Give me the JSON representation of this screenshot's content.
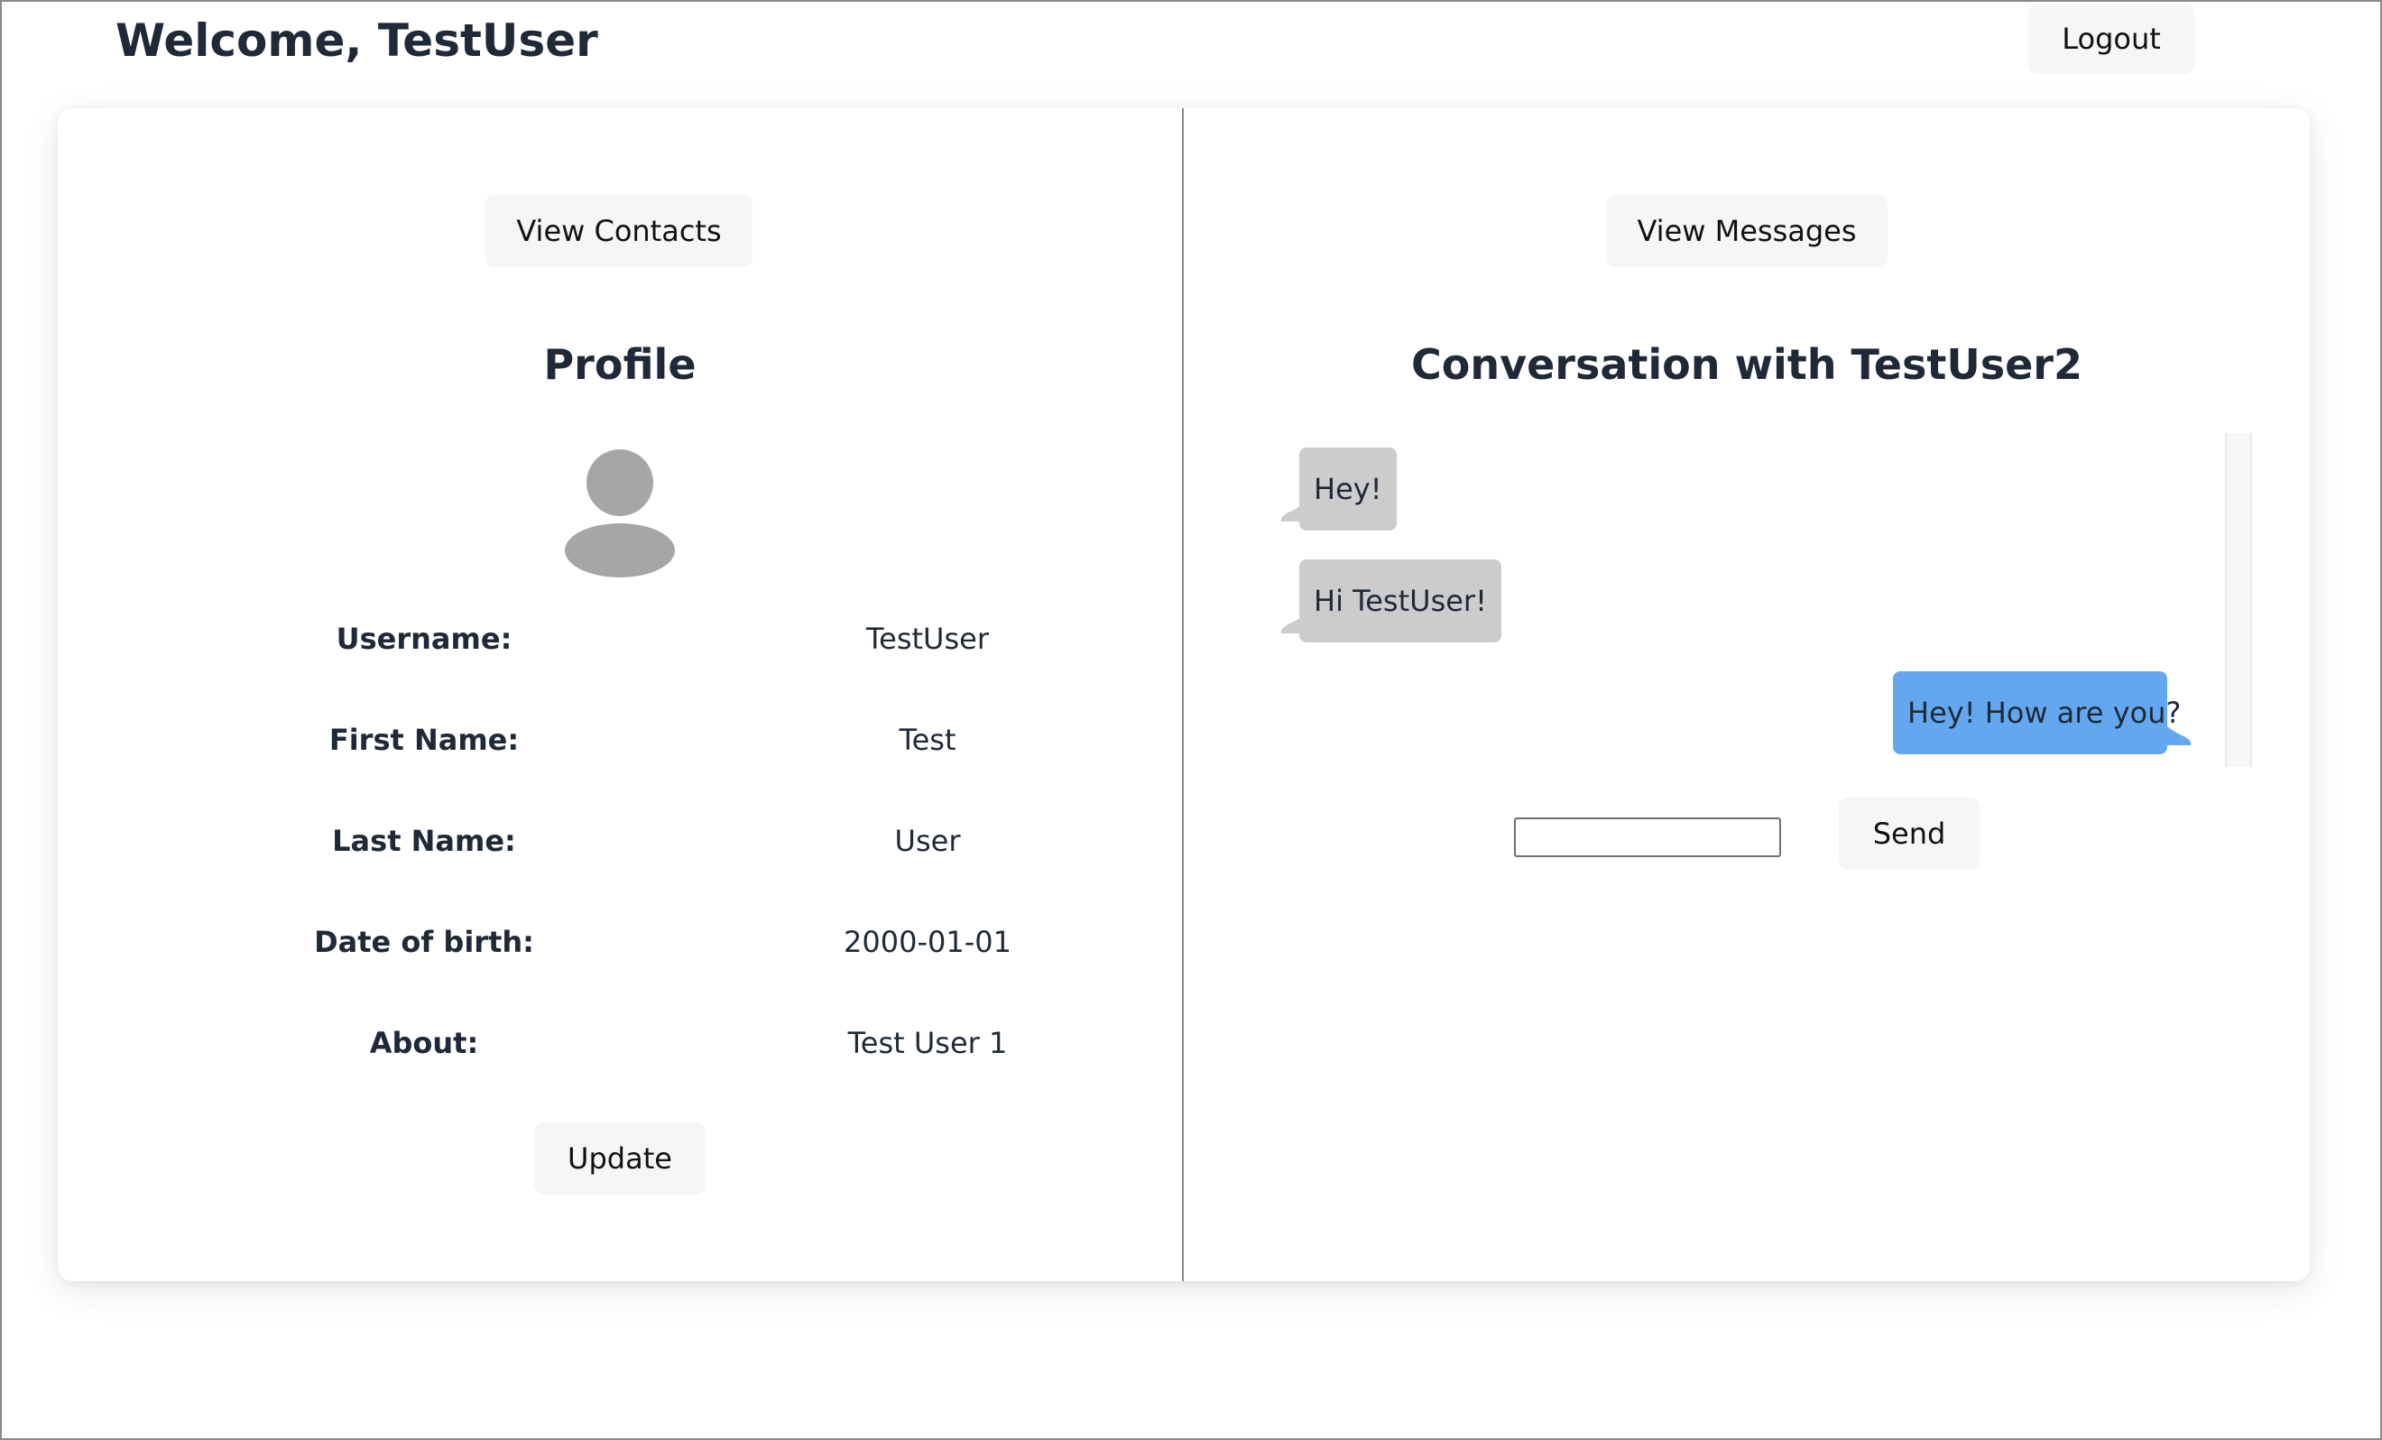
{
  "header": {
    "welcome": "Welcome, TestUser",
    "logout_label": "Logout"
  },
  "left_panel": {
    "view_contacts_label": "View Contacts",
    "title": "Profile",
    "avatar_icon": "user-avatar-icon",
    "fields": [
      {
        "label": "Username:",
        "value": "TestUser"
      },
      {
        "label": "First Name:",
        "value": "Test"
      },
      {
        "label": "Last Name:",
        "value": "User"
      },
      {
        "label": "Date of birth:",
        "value": "2000-01-01"
      },
      {
        "label": "About:",
        "value": "Test User 1"
      }
    ],
    "update_label": "Update"
  },
  "right_panel": {
    "view_messages_label": "View Messages",
    "title": "Conversation with TestUser2",
    "messages": [
      {
        "text": "Hey!",
        "direction": "received"
      },
      {
        "text": "Hi TestUser!",
        "direction": "received"
      },
      {
        "text": "Hey! How are you?",
        "direction": "sent"
      }
    ],
    "input_value": "",
    "input_placeholder": "",
    "send_label": "Send"
  },
  "colors": {
    "received_bubble": "#cccccc",
    "sent_bubble": "#63a8ef",
    "button_bg": "#f6f6f6",
    "text": "#1f2937",
    "divider": "#8a8a8a"
  }
}
